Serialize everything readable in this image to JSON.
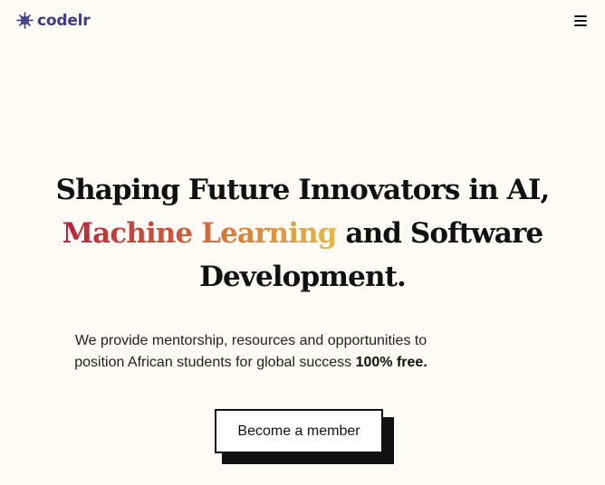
{
  "header": {
    "logo_text": "codelr",
    "logo_icon": "codelr-logo-icon",
    "menu_icon": "hamburger-menu-icon"
  },
  "hero": {
    "title_line1": "Shaping Future Innovators in AI,",
    "title_grad": "Machine Learning",
    "title_line2_rest": " and Software",
    "title_line3": "Development.",
    "subtitle_text": "We provide mentorship, resources and opportunities to position African students for global success ",
    "subtitle_bold": "100% free.",
    "cta_label": "Become a member"
  },
  "colors": {
    "brand": "#3d3a8c",
    "background": "#fefaf5",
    "gradient_start": "#b3273a",
    "gradient_end": "#e6b84a",
    "text": "#111111"
  }
}
